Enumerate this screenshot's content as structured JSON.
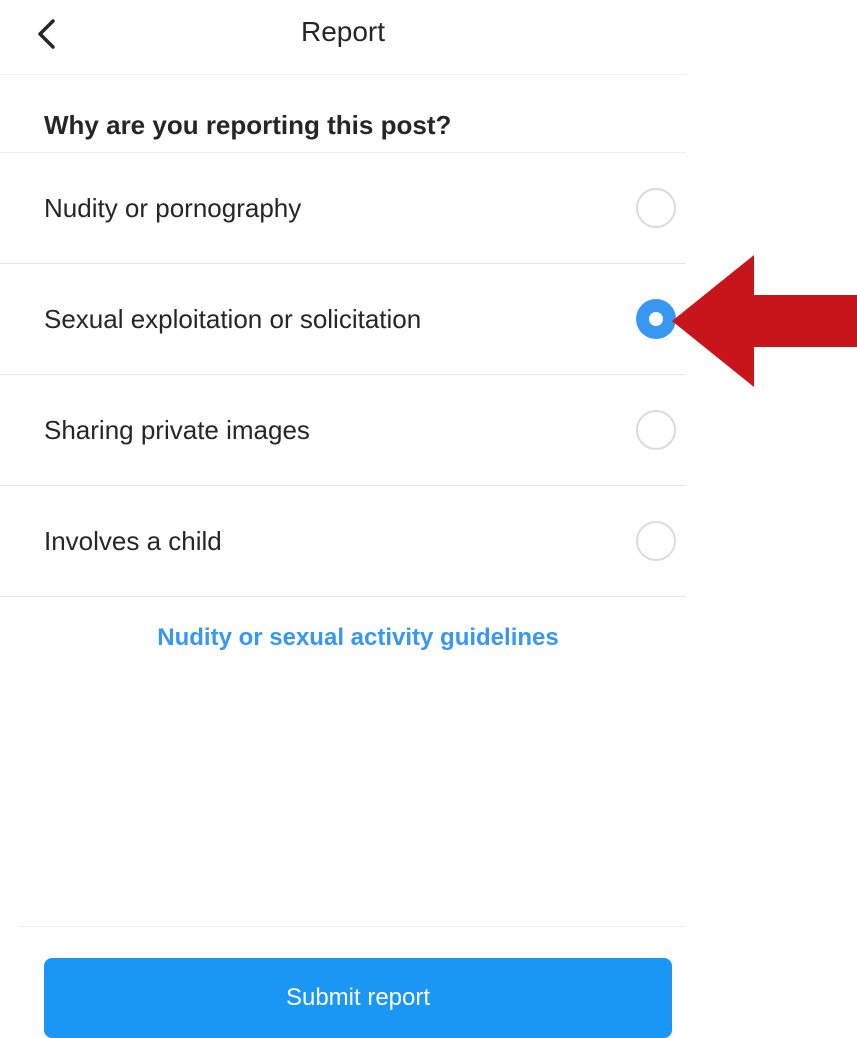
{
  "header": {
    "back_icon": "chevron-left-icon",
    "title": "Report"
  },
  "question": "Why are you reporting this post?",
  "options": [
    {
      "label": "Nudity or pornography",
      "selected": false
    },
    {
      "label": "Sexual exploitation or solicitation",
      "selected": true
    },
    {
      "label": "Sharing private images",
      "selected": false
    },
    {
      "label": "Involves a child",
      "selected": false
    }
  ],
  "guidelines_link": "Nudity or sexual activity guidelines",
  "submit_label": "Submit report",
  "colors": {
    "accent": "#3897f0",
    "button": "#1a97f5",
    "annotation_arrow": "#c8151b"
  }
}
